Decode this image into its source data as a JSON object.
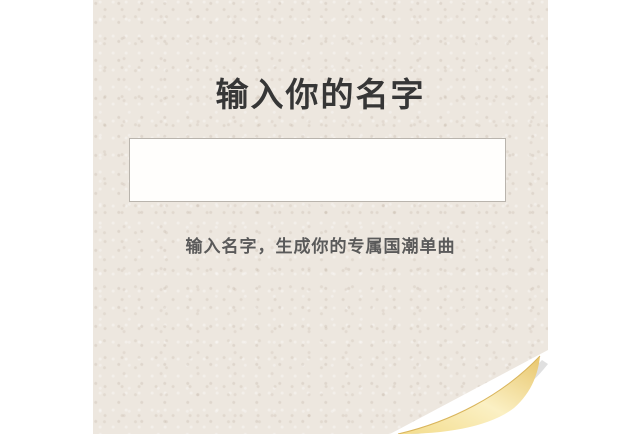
{
  "page": {
    "title": "输入你的名字",
    "subtitle": "输入名字，生成你的专属国潮单曲",
    "name_input": {
      "value": "",
      "placeholder": ""
    }
  },
  "colors": {
    "paper": "#ede7df",
    "title_text": "#363636",
    "subtitle_text": "#5a5a5a",
    "input_background": "#fffefc",
    "input_border": "#b9b4ad",
    "curl_highlight": "#f7e6a6",
    "curl_shadow": "#e8c66c"
  },
  "icons": {
    "decoration": "page-curl"
  }
}
